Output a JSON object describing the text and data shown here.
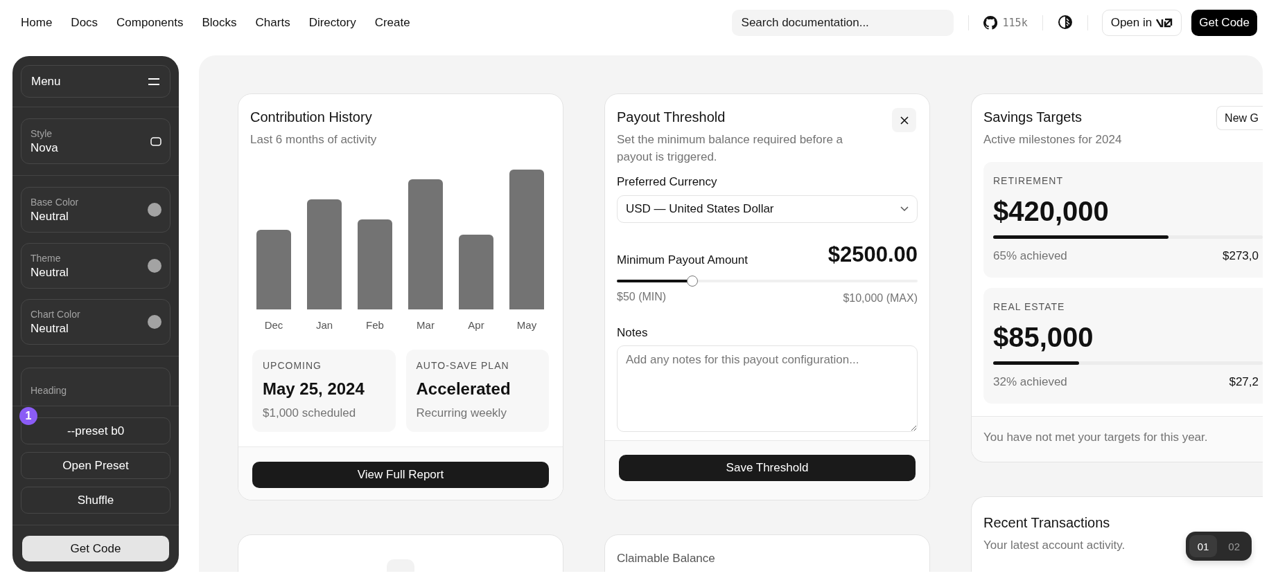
{
  "nav": {
    "links": [
      "Home",
      "Docs",
      "Components",
      "Blocks",
      "Charts",
      "Directory",
      "Create"
    ],
    "search": {
      "placeholder": "Search documentation..."
    },
    "github_stars": "115k",
    "open_in_button": "Open in",
    "get_code_button": "Get Code"
  },
  "sidebar": {
    "menu_label": "Menu",
    "groups": [
      {
        "items": [
          {
            "kind": "shape",
            "label": "Style",
            "value": "Nova"
          }
        ]
      },
      {
        "items": [
          {
            "kind": "swatch",
            "label": "Base Color",
            "value": "Neutral"
          },
          {
            "kind": "swatch",
            "label": "Theme",
            "value": "Neutral"
          },
          {
            "kind": "swatch",
            "label": "Chart Color",
            "value": "Neutral"
          }
        ]
      },
      {
        "items": [
          {
            "kind": "font",
            "label": "Heading"
          }
        ]
      }
    ],
    "preset_badge": "1",
    "buttons": [
      "--preset b0",
      "Open Preset",
      "Shuffle"
    ],
    "get_code_button": "Get Code"
  },
  "contribution_card": {
    "title": "Contribution History",
    "subtitle": "Last 6 months of activity",
    "months": [
      "Dec",
      "Jan",
      "Feb",
      "Mar",
      "Apr",
      "May"
    ],
    "stats": [
      {
        "label": "UPCOMING",
        "value": "May 25, 2024",
        "note": "$1,000 scheduled"
      },
      {
        "label": "AUTO-SAVE PLAN",
        "value": "Accelerated",
        "note": "Recurring weekly"
      }
    ],
    "button": "View Full Report"
  },
  "payout_card": {
    "title": "Payout Threshold",
    "description": "Set the minimum balance required before a payout is triggered.",
    "currency_label": "Preferred Currency",
    "currency_value": "USD — United States Dollar",
    "amount_label": "Minimum Payout Amount",
    "amount": "$2500.00",
    "slider": {
      "level": 0.25
    },
    "min_label": "$50 (MIN)",
    "max_label": "$10,000 (MAX)",
    "notes_label": "Notes",
    "notes_placeholder": "Add any notes for this payout configuration...",
    "button": "Save Threshold"
  },
  "savings_card": {
    "title": "Savings Targets",
    "new_button": "New G",
    "subtitle": "Active milestones for 2024",
    "goals": [
      {
        "label": "RETIREMENT",
        "amount": "$420,000",
        "level": 0.65,
        "progress": "65% achieved",
        "saved": "$273,0"
      },
      {
        "label": "REAL ESTATE",
        "amount": "$85,000",
        "level": 0.32,
        "progress": "32% achieved",
        "saved": "$27,2"
      }
    ],
    "footer": "You have not met your targets for this year."
  },
  "balance_card": {
    "title": "Claimable Balance"
  },
  "transactions_card": {
    "title": "Recent Transactions",
    "subtitle": "Your latest account activity."
  },
  "pager": [
    {
      "label": "01",
      "selected": true
    },
    {
      "label": "02",
      "selected": false
    }
  ]
}
